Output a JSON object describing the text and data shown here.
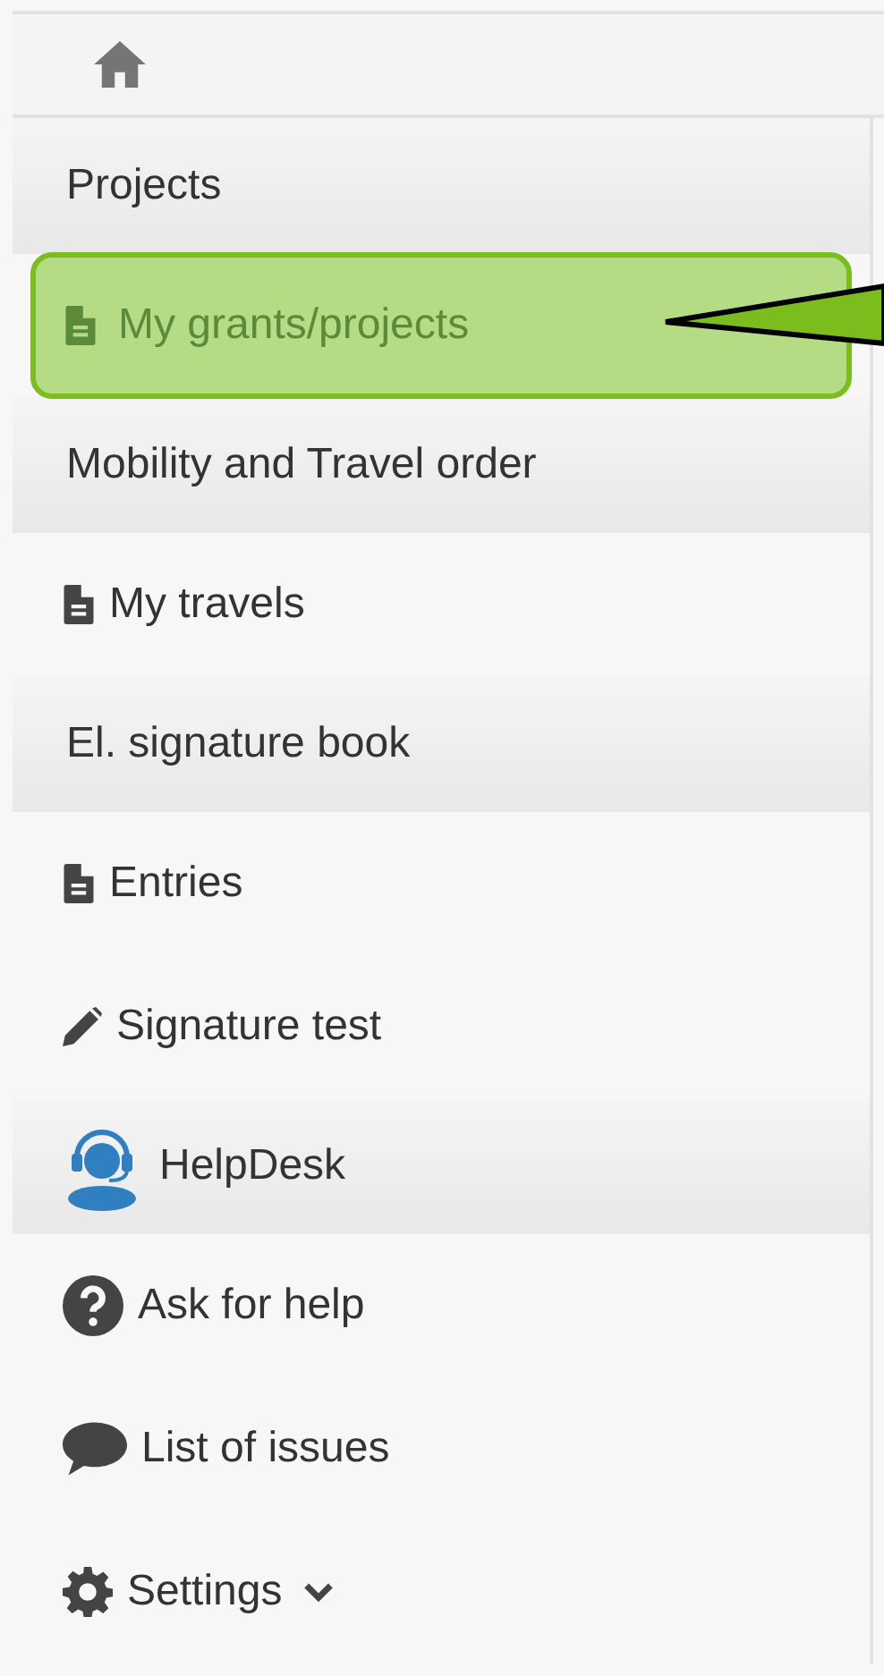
{
  "sections": [
    {
      "title": "Projects",
      "items": [
        {
          "label": "My grants/projects",
          "selected": true
        }
      ]
    },
    {
      "title": "Mobility and Travel order",
      "items": [
        {
          "label": "My travels",
          "selected": false
        }
      ]
    },
    {
      "title": "El. signature book",
      "items": [
        {
          "label": "Entries",
          "selected": false
        },
        {
          "label": "Signature test",
          "selected": false
        }
      ]
    },
    {
      "title": "HelpDesk",
      "items": [
        {
          "label": "Ask for help",
          "selected": false
        },
        {
          "label": "List of issues",
          "selected": false
        },
        {
          "label": "Settings",
          "selected": false
        }
      ]
    }
  ]
}
